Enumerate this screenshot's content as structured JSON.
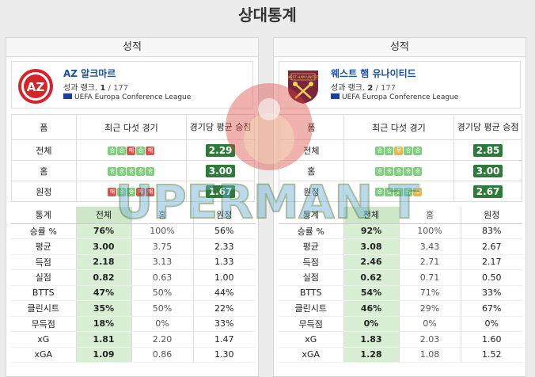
{
  "page_title": "상대통계",
  "panel_header": "성적",
  "teams": [
    {
      "name": "AZ 알크마르",
      "rank_label": "성과 랭크.",
      "rank": "1",
      "rank_total": "/ 177",
      "league": "UEFA Europa Conference League",
      "logo_text": "AZ",
      "form_headers": {
        "label": "폼",
        "games": "최근 다섯 경기",
        "avg": "경기당 평균 승점"
      },
      "form_rows": [
        {
          "label": "전체",
          "results": [
            "W",
            "W",
            "L",
            "W",
            "L"
          ],
          "avg": "2.29"
        },
        {
          "label": "홈",
          "results": [
            "W",
            "W",
            "W",
            "W",
            "W"
          ],
          "avg": "3.00"
        },
        {
          "label": "원정",
          "results": [
            "L",
            "W",
            "W",
            "L",
            "L"
          ],
          "avg": "1.67"
        }
      ],
      "stats_headers": [
        "통계",
        "전체",
        "홈",
        "원정"
      ],
      "stats_rows": [
        {
          "label": "승률 %",
          "all": "76%",
          "home": "100%",
          "away": "56%"
        },
        {
          "label": "평균",
          "all": "3.00",
          "home": "3.75",
          "away": "2.33"
        },
        {
          "label": "득점",
          "all": "2.18",
          "home": "3.13",
          "away": "1.33"
        },
        {
          "label": "실점",
          "all": "0.82",
          "home": "0.63",
          "away": "1.00"
        },
        {
          "label": "BTTS",
          "all": "47%",
          "home": "50%",
          "away": "44%"
        },
        {
          "label": "클린시트",
          "all": "35%",
          "home": "50%",
          "away": "22%"
        },
        {
          "label": "무득점",
          "all": "18%",
          "home": "0%",
          "away": "33%"
        },
        {
          "label": "xG",
          "all": "1.81",
          "home": "2.20",
          "away": "1.47"
        },
        {
          "label": "xGA",
          "all": "1.09",
          "home": "0.86",
          "away": "1.30"
        }
      ]
    },
    {
      "name": "웨스트 햄 유나이티드",
      "rank_label": "성과 랭크.",
      "rank": "2",
      "rank_total": "/ 177",
      "league": "UEFA Europa Conference League",
      "logo_text": "WEST HAM UNITED",
      "form_headers": {
        "label": "폼",
        "games": "최근 다섯 경기",
        "avg": "경기당 평균 승점"
      },
      "form_rows": [
        {
          "label": "전체",
          "results": [
            "W",
            "W",
            "D",
            "W",
            "W"
          ],
          "avg": "2.85"
        },
        {
          "label": "홈",
          "results": [
            "W",
            "W",
            "W",
            "W",
            "W"
          ],
          "avg": "3.00"
        },
        {
          "label": "원정",
          "results": [
            "W",
            "W",
            "W",
            "W",
            "D"
          ],
          "avg": "2.67"
        }
      ],
      "stats_headers": [
        "통계",
        "전체",
        "홈",
        "원정"
      ],
      "stats_rows": [
        {
          "label": "승률 %",
          "all": "92%",
          "home": "100%",
          "away": "83%"
        },
        {
          "label": "평균",
          "all": "3.08",
          "home": "3.43",
          "away": "2.67"
        },
        {
          "label": "득점",
          "all": "2.46",
          "home": "2.71",
          "away": "2.17"
        },
        {
          "label": "실점",
          "all": "0.62",
          "home": "0.71",
          "away": "0.50"
        },
        {
          "label": "BTTS",
          "all": "54%",
          "home": "71%",
          "away": "33%"
        },
        {
          "label": "클린시트",
          "all": "46%",
          "home": "29%",
          "away": "67%"
        },
        {
          "label": "무득점",
          "all": "0%",
          "home": "0%",
          "away": "0%"
        },
        {
          "label": "xG",
          "all": "1.83",
          "home": "2.03",
          "away": "1.60"
        },
        {
          "label": "xGA",
          "all": "1.28",
          "home": "1.08",
          "away": "1.52"
        }
      ]
    }
  ],
  "result_glyphs": {
    "W": "승",
    "D": "무",
    "L": "패"
  },
  "watermark_text": "SUPERMAN TV",
  "colors": {
    "win": "#7fcf7f",
    "draw": "#e8b84a",
    "loss": "#d9534f",
    "badge": "#2f7a3a",
    "team_link": "#1a4fa8",
    "highlight_col": "#d8efd4"
  }
}
